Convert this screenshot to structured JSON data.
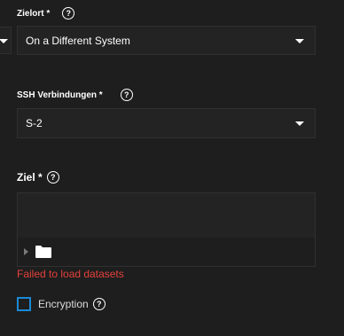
{
  "destination_field": {
    "label": "Zielort *",
    "selected": "On a Different System"
  },
  "ssh_field": {
    "label": "SSH Verbindungen *",
    "selected": "S-2"
  },
  "target_field": {
    "label": "Ziel *",
    "error": "Failed to load datasets"
  },
  "encryption": {
    "label": "Encryption",
    "checked": false
  },
  "colors": {
    "background": "#1e1e1e",
    "field": "#232323",
    "error": "#e3413b",
    "checkbox_border": "#1a8ad6"
  }
}
